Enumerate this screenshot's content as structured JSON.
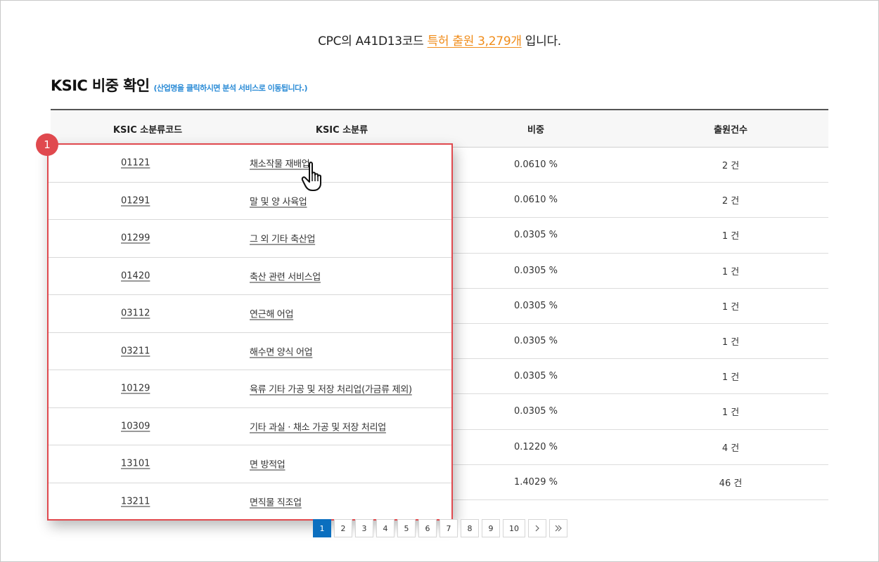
{
  "header": {
    "prefix": "CPC의 A41D13코드",
    "link": "특허 출원 3,279개",
    "suffix": "입니다."
  },
  "section": {
    "title": "KSIC 비중 확인",
    "subtitle": "(산업명을 클릭하시면 분석 서비스로 이동됩니다.)"
  },
  "table": {
    "columns": [
      "KSIC 소분류코드",
      "KSIC 소분류",
      "비중",
      "출원건수"
    ],
    "rows": [
      {
        "code": "01121",
        "name": "채소작물 재배업",
        "ratio": "0.0610 %",
        "count": "2 건"
      },
      {
        "code": "01291",
        "name": "말 및 양 사육업",
        "ratio": "0.0610 %",
        "count": "2 건"
      },
      {
        "code": "01299",
        "name": "그 외 기타 축산업",
        "ratio": "0.0305 %",
        "count": "1 건"
      },
      {
        "code": "01420",
        "name": "축산 관련 서비스업",
        "ratio": "0.0305 %",
        "count": "1 건"
      },
      {
        "code": "03112",
        "name": "연근해 어업",
        "ratio": "0.0305 %",
        "count": "1 건"
      },
      {
        "code": "03211",
        "name": "해수면 양식 어업",
        "ratio": "0.0305 %",
        "count": "1 건"
      },
      {
        "code": "10129",
        "name": "육류 기타 가공 및 저장 처리업(가금류 제외)",
        "ratio": "0.0305 %",
        "count": "1 건"
      },
      {
        "code": "10309",
        "name": "기타 과실 · 채소 가공 및 저장 처리업",
        "ratio": "0.0305 %",
        "count": "1 건"
      },
      {
        "code": "13101",
        "name": "면 방적업",
        "ratio": "0.1220 %",
        "count": "4 건"
      },
      {
        "code": "13211",
        "name": "면직물 직조업",
        "ratio": "1.4029 %",
        "count": "46 건"
      }
    ]
  },
  "annotation": {
    "badge": "1"
  },
  "pagination": {
    "pages": [
      "1",
      "2",
      "3",
      "4",
      "5",
      "6",
      "7",
      "8",
      "9",
      "10"
    ],
    "active": "1",
    "next_icon": "chevron-right-icon",
    "last_icon": "double-chevron-right-icon"
  },
  "colors": {
    "accent_link": "#f08c1a",
    "subtitle": "#2a8bd6",
    "highlight_border": "#e0494e",
    "active_page": "#0b6fbf"
  }
}
